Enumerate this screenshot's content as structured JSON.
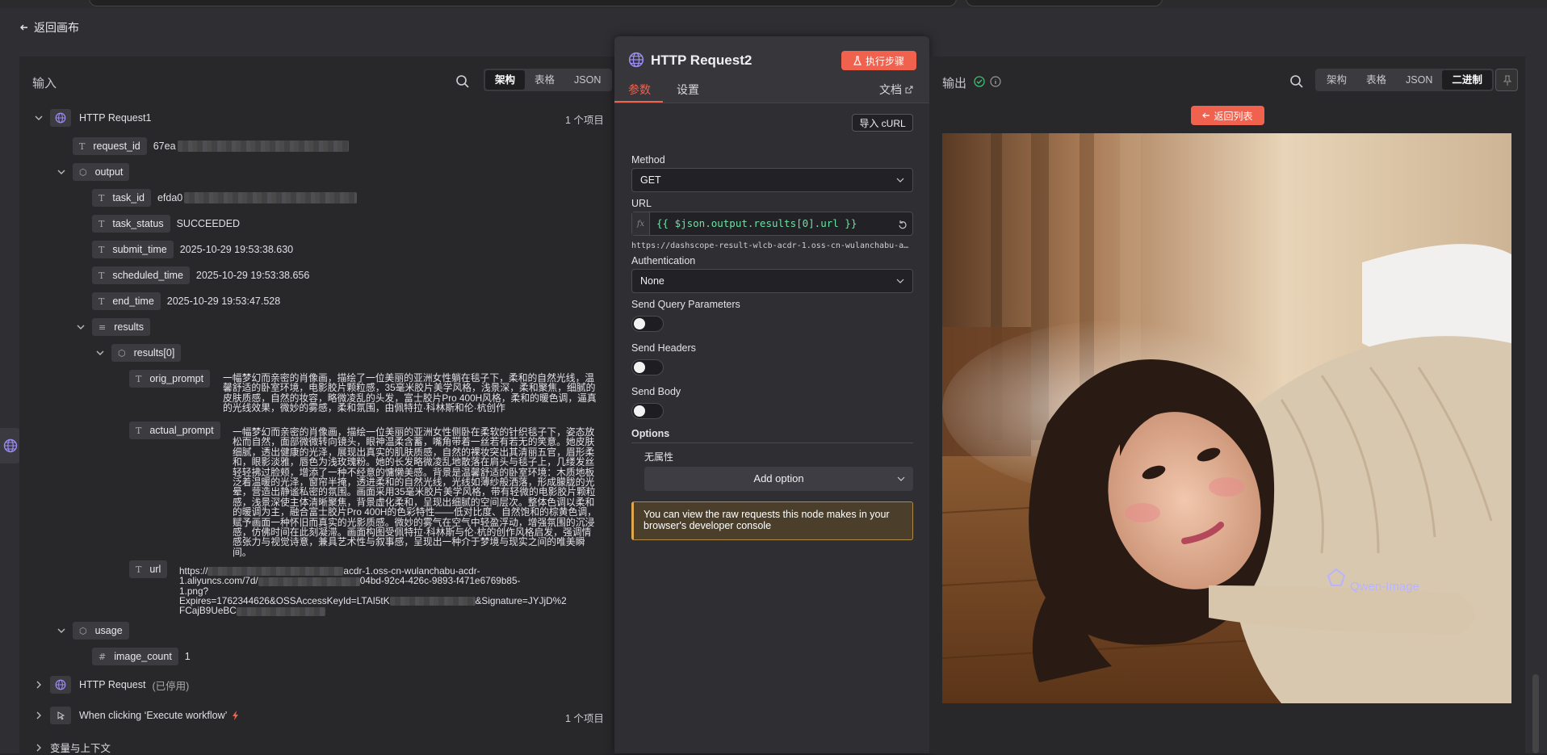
{
  "back_label": "返回画布",
  "input_panel": {
    "title": "输入",
    "view_tabs": [
      "架构",
      "表格",
      "JSON"
    ],
    "active_tab": "架构",
    "tree": {
      "node1": {
        "name": "HTTP Request1",
        "count": "1 个项目"
      },
      "request_id": {
        "key": "request_id",
        "value": "67ea"
      },
      "output": {
        "key": "output"
      },
      "task_id": {
        "key": "task_id",
        "value": "efda0"
      },
      "task_status": {
        "key": "task_status",
        "value": "SUCCEEDED"
      },
      "submit_time": {
        "key": "submit_time",
        "value": "2025-10-29 19:53:38.630"
      },
      "scheduled_time": {
        "key": "scheduled_time",
        "value": "2025-10-29 19:53:38.656"
      },
      "end_time": {
        "key": "end_time",
        "value": "2025-10-29 19:53:47.528"
      },
      "results": {
        "key": "results"
      },
      "results0": {
        "key": "results[0]"
      },
      "orig_prompt": {
        "key": "orig_prompt",
        "value": "一幅梦幻而亲密的肖像画，描绘了一位美丽的亚洲女性躺在毯子下，柔和的自然光线，温馨舒适的卧室环境，电影胶片颗粒感，35毫米胶片美学风格，浅景深，柔和聚焦，细腻的皮肤质感，自然的妆容，略微凌乱的头发，富士胶片Pro 400H风格，柔和的暖色调，逼真的光线效果，微妙的雾感，柔和氛围，由佩特拉·科林斯和伦·杭创作"
      },
      "actual_prompt": {
        "key": "actual_prompt",
        "value": "一幅梦幻而亲密的肖像画，描绘一位美丽的亚洲女性侧卧在柔软的针织毯子下，姿态放松而自然，面部微微转向镜头，眼神温柔含蓄，嘴角带着一丝若有若无的笑意。她皮肤细腻，透出健康的光泽，展现出真实的肌肤质感，自然的裸妆突出其清丽五官，眉形柔和，眼影淡雅，唇色为浅玫瑰粉。她的长发略微凌乱地散落在肩头与毯子上，几缕发丝轻轻拂过脸颊，增添了一种不经意的慵懒美感。背景是温馨舒适的卧室环境：木质地板泛着温暖的光泽，窗帘半掩，透进柔和的自然光线，光线如薄纱般洒落，形成朦胧的光晕，营造出静谧私密的氛围。画面采用35毫米胶片美学风格，带有轻微的电影胶片颗粒感，浅景深使主体清晰聚焦，背景虚化柔和，呈现出细腻的空间层次。整体色调以柔和的暖调为主，融合富士胶片Pro 400H的色彩特性——低对比度、自然饱和的棕黄色调，赋予画面一种怀旧而真实的光影质感。微妙的雾气在空气中轻盈浮动，增强氛围的沉浸感，仿佛时间在此刻凝滞。画面构图受佩特拉·科林斯与伦·杭的创作风格启发，强调情感张力与视觉诗意，兼具艺术性与叙事感，呈现出一种介于梦境与现实之间的唯美瞬间。"
      },
      "url": {
        "key": "url",
        "line1": "https://",
        "line1b": "acdr-1.oss-cn-wulanchabu-acdr-",
        "line2": "1.aliyuncs.com/7d/",
        "line2b": "04bd-92c4-426c-9893-f471e6769b85-",
        "line3": "1.png?",
        "line4": "Expires=1762344626&OSSAccessKeyId=LTAI5tK",
        "line4b": "&Signature=JYJjD%2",
        "line5": "FCajB9UeBC"
      },
      "usage": {
        "key": "usage"
      },
      "image_count": {
        "key": "image_count",
        "value": "1"
      },
      "node2": {
        "name": "HTTP Request",
        "note": "(已停用)"
      },
      "node3": {
        "name": "When clicking ‘Execute workflow’",
        "count": "1 个项目"
      },
      "vars": {
        "name": "变量与上下文"
      }
    }
  },
  "node_panel": {
    "title": "HTTP Request2",
    "execute_label": "执行步骤",
    "tabs": [
      "参数",
      "设置"
    ],
    "docs_label": "文档",
    "import_curl": "导入 cURL",
    "method_label": "Method",
    "method_value": "GET",
    "url_label": "URL",
    "url_expression": "{{ $json.output.results[0].url }}",
    "url_preview": "https://dashscope-result-wlcb-acdr-1.oss-cn-wulanchabu-a…",
    "auth_label": "Authentication",
    "auth_value": "None",
    "send_query_label": "Send Query Parameters",
    "send_query_on": false,
    "send_headers_label": "Send Headers",
    "send_headers_on": false,
    "send_body_label": "Send Body",
    "send_body_on": false,
    "options_label": "Options",
    "no_props": "无属性",
    "add_option": "Add option",
    "notice": "You can view the raw requests this node makes in your browser's developer console"
  },
  "output_panel": {
    "title": "输出",
    "view_tabs": [
      "架构",
      "表格",
      "JSON",
      "二进制"
    ],
    "active_tab": "二进制",
    "back_to_list": "返回列表",
    "watermark": "Qwen-Image"
  },
  "colors": {
    "accent": "#f0614e",
    "success": "#3bbf6f",
    "expr": "#6fe0a4"
  }
}
